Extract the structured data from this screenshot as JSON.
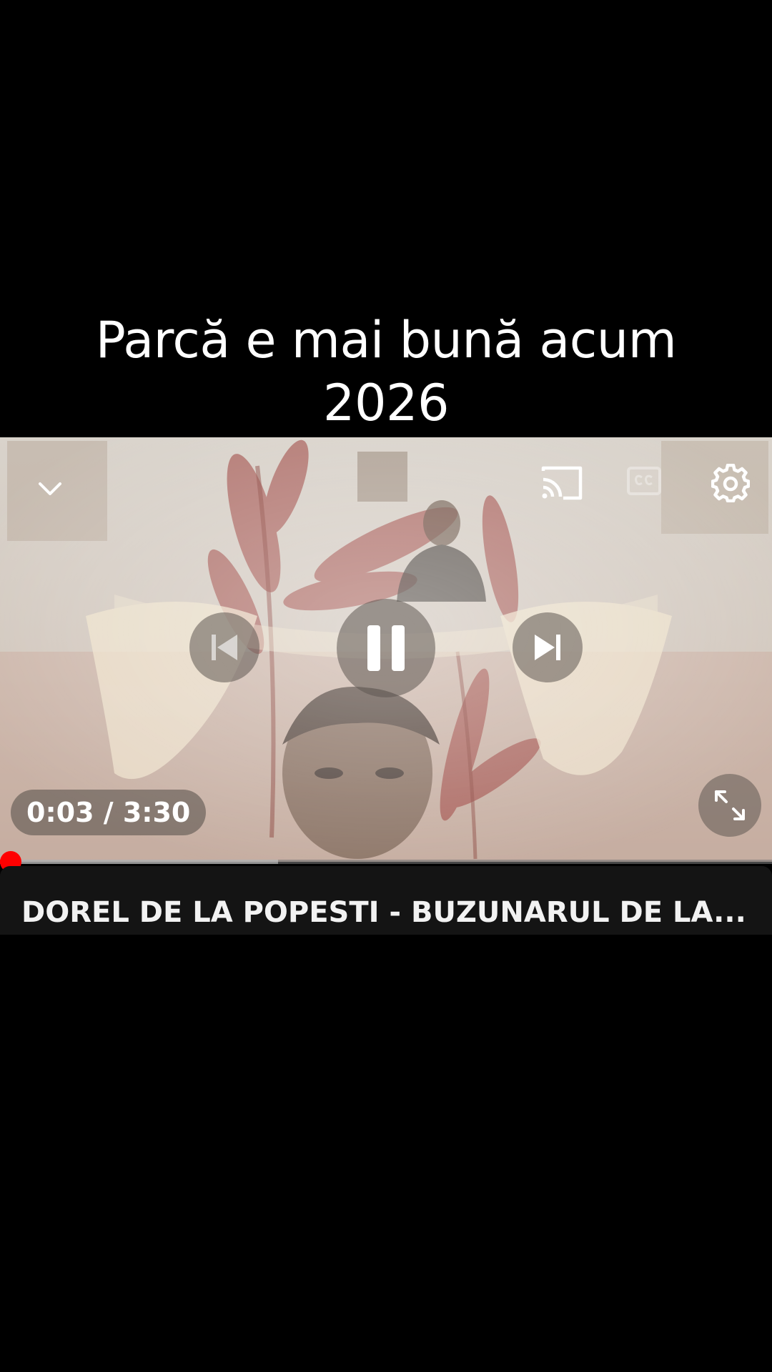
{
  "caption": {
    "line1": "Parcă e mai bună acum",
    "line2": "2026"
  },
  "player": {
    "time_display": "0:03 / 3:30",
    "progress_fraction": 0.014,
    "buffered_fraction": 0.36,
    "video_title": "DOREL DE LA POPESTI - BUZUNARUL DE LA...",
    "icons": {
      "collapse": "chevron-down-icon",
      "cast": "cast-icon",
      "captions": "closed-captions-icon",
      "settings": "gear-icon",
      "previous": "skip-previous-icon",
      "pause": "pause-icon",
      "next": "skip-next-icon",
      "fullscreen": "fullscreen-icon"
    },
    "accent_color": "#ff0000"
  }
}
